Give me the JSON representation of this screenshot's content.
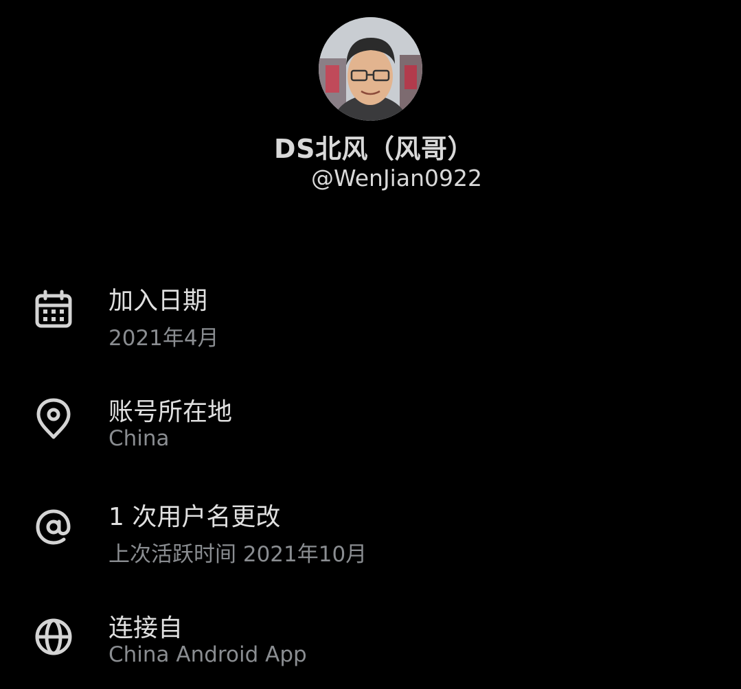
{
  "profile": {
    "display_name": "DS北风（风哥）",
    "handle": "@WenJian0922"
  },
  "about": {
    "items": [
      {
        "icon": "calendar-icon",
        "title": "加入日期",
        "subtitle": "2021年4月"
      },
      {
        "icon": "location-pin-icon",
        "title": "账号所在地",
        "subtitle": "China"
      },
      {
        "icon": "at-sign-icon",
        "title": "1 次用户名更改",
        "subtitle": "上次活跃时间 2021年10月"
      },
      {
        "icon": "globe-icon",
        "title": "连接自",
        "subtitle": "China Android App"
      }
    ]
  },
  "colors": {
    "background": "#000000",
    "primary_text": "#e0e0e0",
    "secondary_text": "#8a8d91"
  }
}
